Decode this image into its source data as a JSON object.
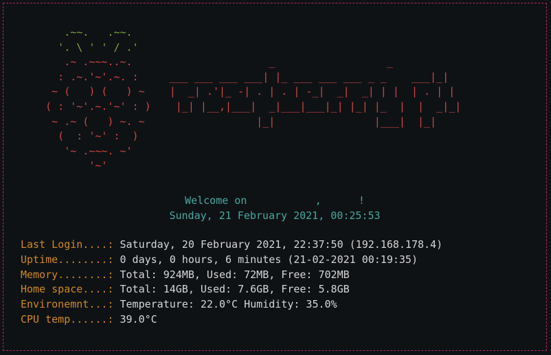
{
  "colors": {
    "background": "#0f1215",
    "border": "#b0286a",
    "raspberry_leaves": "#7fa838",
    "raspberry_body": "#d04646",
    "banner": "#d04646",
    "welcome": "#48a8a0",
    "label": "#d08a20",
    "value": "#d6d6d6"
  },
  "ascii": {
    "lines": [
      {
        "leaf": "       .~~.   .~~.",
        "body": "",
        "banner": ""
      },
      {
        "leaf": "      '. \\ ' ' / .'",
        "body": "",
        "banner": ""
      },
      {
        "leaf": "",
        "body": "       .~ .~~~..~.",
        "banner": "                      _                  _"
      },
      {
        "leaf": "",
        "body": "      : .~.'~'.~. :",
        "banner": "     ___ ___ ___ ___| |_ ___ ___ ___ _ _    ___|_|"
      },
      {
        "leaf": "",
        "body": "     ~ (   ) (   ) ~",
        "banner": "    |  _| .'|_ -| . | . | -_|  _|  _| | |  | . | |"
      },
      {
        "leaf": "",
        "body": "    ( : '~'.~.'~' : )",
        "banner": "    |_| |__,|___|  _|___|___|_| |_| |_  |  |  _|_|"
      },
      {
        "leaf": "",
        "body": "     ~ .~ (   ) ~. ~",
        "banner": "                  |_|                |___|  |_|"
      },
      {
        "leaf": "",
        "body": "      (  : '~' :  )",
        "banner": ""
      },
      {
        "leaf": "",
        "body": "       '~ .~~~. ~'",
        "banner": ""
      },
      {
        "leaf": "",
        "body": "           '~'",
        "banner": ""
      }
    ]
  },
  "welcome": {
    "line1": "Welcome on           ,      !",
    "line2": "Sunday, 21 February 2021, 00:25:53"
  },
  "info": [
    {
      "label": "Last Login....:",
      "value": " Saturday, 20 February 2021, 22:37:50 (192.168.178.4)"
    },
    {
      "label": "Uptime........:",
      "value": " 0 days, 0 hours, 6 minutes (21-02-2021 00:19:35)"
    },
    {
      "label": "Memory........:",
      "value": " Total: 924MB, Used: 72MB, Free: 702MB"
    },
    {
      "label": "Home space....:",
      "value": " Total: 14GB, Used: 7.6GB, Free: 5.8GB"
    },
    {
      "label": "Environemnt...:",
      "value": " Temperature: 22.0°C Humidity: 35.0%"
    },
    {
      "label": "CPU temp......:",
      "value": " 39.0°C"
    }
  ]
}
